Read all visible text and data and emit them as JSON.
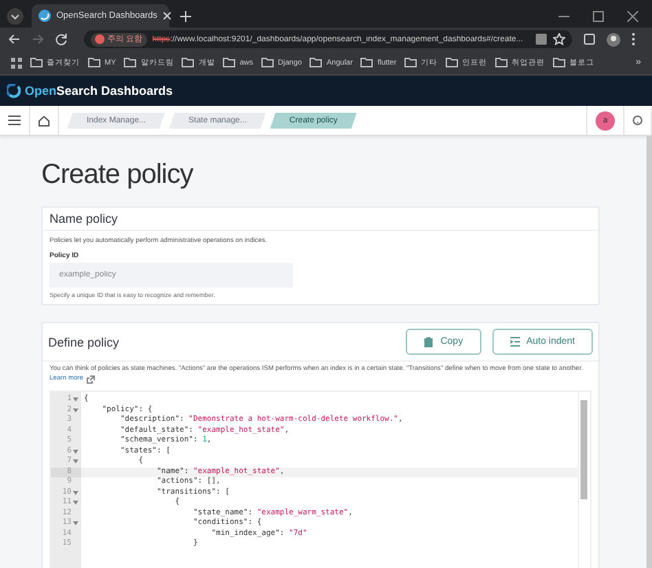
{
  "browser": {
    "tab_title": "OpenSearch Dashboards",
    "security_chip": "주의 요함",
    "url_scheme": "https",
    "url_rest": "://www.localhost:9201/_dashboards/app/opensearch_index_management_dashboards#/create...",
    "bookmarks": [
      "즐겨찾기",
      "MY",
      "알카드림",
      "개발",
      "aws",
      "Django",
      "Angular",
      "flutter",
      "기타",
      "인프런",
      "취업관련",
      "블로그"
    ],
    "more": "»"
  },
  "header": {
    "brand_prefix": "Open",
    "brand_rest": "Search Dashboards"
  },
  "breadcrumbs": [
    {
      "label": "Index Manage...",
      "selected": false
    },
    {
      "label": "State manage...",
      "selected": false
    },
    {
      "label": "Create policy",
      "selected": true
    }
  ],
  "avatar": "a",
  "page_title": "Create policy",
  "name_panel": {
    "title": "Name policy",
    "description": "Policies let you automatically perform administrative operations on indices.",
    "field_label": "Policy ID",
    "placeholder": "example_policy",
    "help": "Specify a unique ID that is easy to recognize and remember."
  },
  "define_panel": {
    "title": "Define policy",
    "buttons": [
      "Copy",
      "Auto indent"
    ],
    "description": "You can think of policies as state machines. \"Actions\" are the operations ISM performs when an index is in a certain state. \"Transitions\" define when to move from one state to another.",
    "link": "Learn more"
  },
  "editor": {
    "lines": [
      {
        "number": "1",
        "foldable": true,
        "highlighted": false,
        "tokens": [
          {
            "kind": "punct",
            "text": "{"
          }
        ]
      },
      {
        "number": "2",
        "foldable": true,
        "highlighted": false,
        "tokens": [
          {
            "kind": "key",
            "text": "    \"policy\": {"
          }
        ]
      },
      {
        "number": "3",
        "foldable": false,
        "highlighted": false,
        "tokens": [
          {
            "kind": "key",
            "text": "        \"description\": "
          },
          {
            "kind": "string",
            "text": "\"Demonstrate a hot-warm-cold-delete workflow.\""
          },
          {
            "kind": "punct",
            "text": ","
          }
        ]
      },
      {
        "number": "4",
        "foldable": false,
        "highlighted": false,
        "tokens": [
          {
            "kind": "key",
            "text": "        \"default_state\": "
          },
          {
            "kind": "string",
            "text": "\"example_hot_state\""
          },
          {
            "kind": "punct",
            "text": ","
          }
        ]
      },
      {
        "number": "5",
        "foldable": false,
        "highlighted": false,
        "tokens": [
          {
            "kind": "key",
            "text": "        \"schema_version\": "
          },
          {
            "kind": "number",
            "text": "1"
          },
          {
            "kind": "punct",
            "text": ","
          }
        ]
      },
      {
        "number": "6",
        "foldable": true,
        "highlighted": false,
        "tokens": [
          {
            "kind": "key",
            "text": "        \"states\": ["
          }
        ]
      },
      {
        "number": "7",
        "foldable": true,
        "highlighted": false,
        "tokens": [
          {
            "kind": "punct",
            "text": "            {"
          }
        ]
      },
      {
        "number": "8",
        "foldable": false,
        "highlighted": true,
        "tokens": [
          {
            "kind": "key",
            "text": "                \"name\": "
          },
          {
            "kind": "string",
            "text": "\"example_hot_state\""
          },
          {
            "kind": "punct",
            "text": ","
          }
        ]
      },
      {
        "number": "9",
        "foldable": false,
        "highlighted": false,
        "tokens": [
          {
            "kind": "key",
            "text": "                \"actions\": [],"
          }
        ]
      },
      {
        "number": "10",
        "foldable": true,
        "highlighted": false,
        "tokens": [
          {
            "kind": "key",
            "text": "                \"transitions\": ["
          }
        ]
      },
      {
        "number": "11",
        "foldable": true,
        "highlighted": false,
        "tokens": [
          {
            "kind": "punct",
            "text": "                    {"
          }
        ]
      },
      {
        "number": "12",
        "foldable": false,
        "highlighted": false,
        "tokens": [
          {
            "kind": "key",
            "text": "                        \"state_name\": "
          },
          {
            "kind": "string",
            "text": "\"example_warm_state\""
          },
          {
            "kind": "punct",
            "text": ","
          }
        ]
      },
      {
        "number": "13",
        "foldable": true,
        "highlighted": false,
        "tokens": [
          {
            "kind": "key",
            "text": "                        \"conditions\": {"
          }
        ]
      },
      {
        "number": "14",
        "foldable": false,
        "highlighted": false,
        "tokens": [
          {
            "kind": "key",
            "text": "                            \"min_index_age\": "
          },
          {
            "kind": "string",
            "text": "\"7d\""
          }
        ]
      },
      {
        "number": "15",
        "foldable": false,
        "highlighted": false,
        "tokens": [
          {
            "kind": "punct",
            "text": "                        }"
          }
        ]
      }
    ]
  }
}
